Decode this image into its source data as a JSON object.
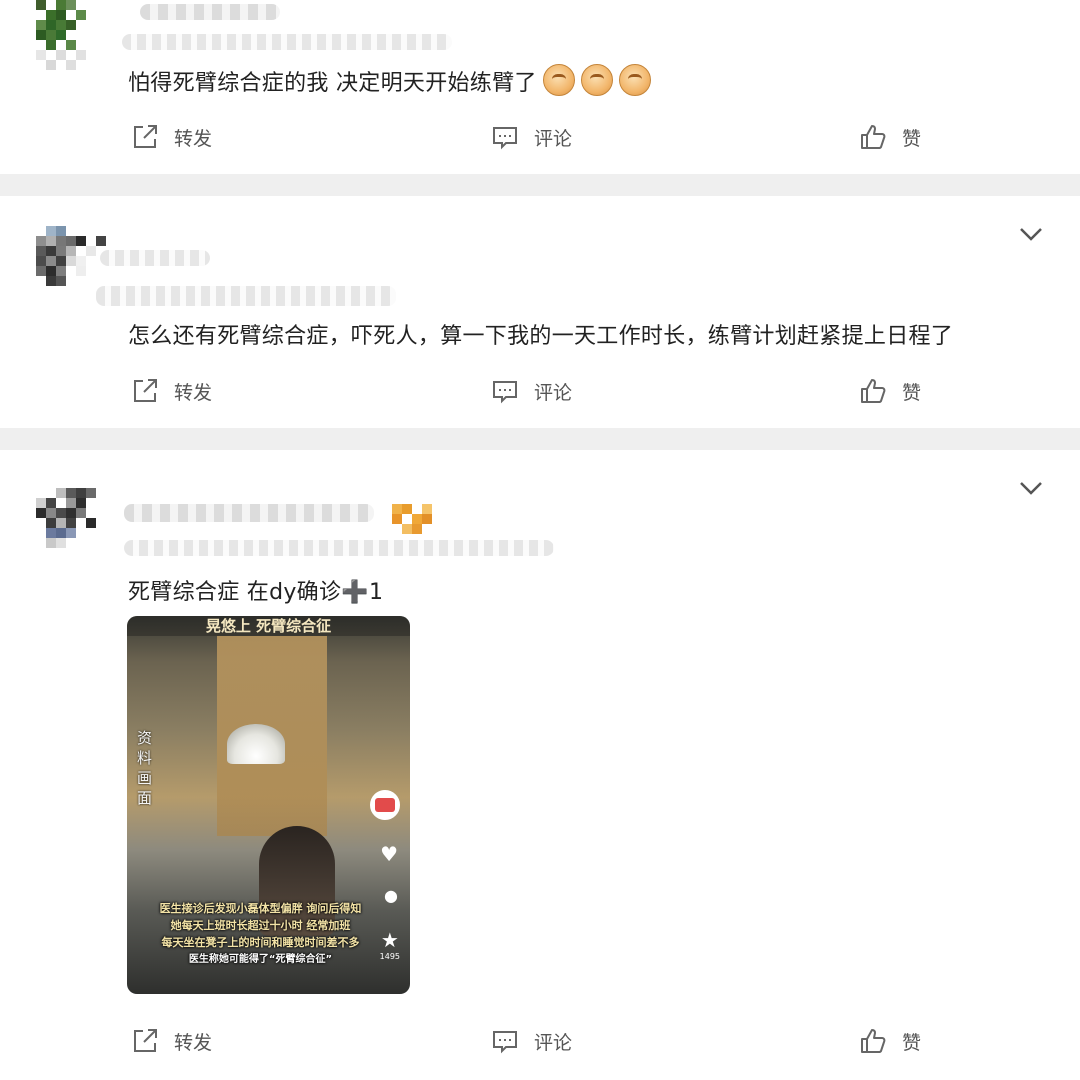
{
  "posts": [
    {
      "text": "怕得死臂综合症的我 决定明天开始练臂了",
      "emoji_count": 3,
      "emoji_icon": "fist-emoji-icon",
      "actions": {
        "repost": "转发",
        "comment": "评论",
        "like": "赞"
      }
    },
    {
      "text": "怎么还有死臂综合症，吓死人，算一下我的一天工作时长，练臂计划赶紧提上日程了",
      "actions": {
        "repost": "转发",
        "comment": "评论",
        "like": "赞"
      }
    },
    {
      "text": "死臂综合症 在dy确诊➕1",
      "video": {
        "title": "晃悠上 死臂综合征",
        "side_label": "资料画面",
        "like_count": "1495",
        "caption_lines": [
          "医生接诊后发现小磊体型偏胖 询问后得知",
          "她每天上班时长超过十小时 经常加班",
          "每天坐在凳子上的时间和睡觉时间差不多",
          "医生称她可能得了“死臂综合征”"
        ]
      },
      "actions": {
        "repost": "转发",
        "comment": "评论",
        "like": "赞"
      }
    }
  ],
  "icons": {
    "repost": "share-out-icon",
    "comment": "comment-bubble-icon",
    "like": "thumbs-up-icon",
    "more": "chevron-down-icon"
  },
  "colors": {
    "page_bg": "#efefef",
    "card_bg": "#ffffff",
    "text": "#222222",
    "action_text": "#555555"
  }
}
